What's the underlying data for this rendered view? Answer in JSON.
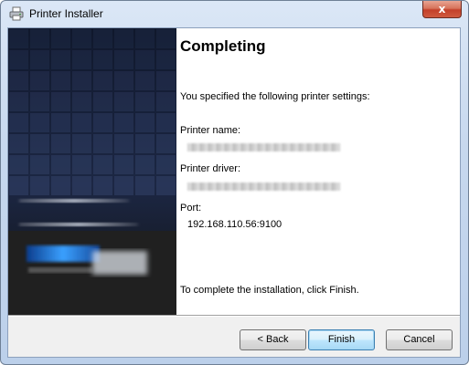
{
  "window": {
    "title": "Printer Installer",
    "close_label": "x"
  },
  "wizard": {
    "heading": "Completing",
    "intro": "You specified the following printer settings:",
    "printer_name_label": "Printer name:",
    "printer_name_value": "",
    "printer_driver_label": "Printer driver:",
    "printer_driver_value": "",
    "port_label": "Port:",
    "port_value": "192.168.110.56:9100",
    "footer": "To complete the installation, click Finish."
  },
  "buttons": {
    "back": "< Back",
    "finish": "Finish",
    "cancel": "Cancel"
  },
  "icons": {
    "title": "printer-icon",
    "close": "close-icon"
  },
  "colors": {
    "banner_dark": "#1a2238",
    "banner_tile": "#2c3a5e",
    "close_red": "#c3402a",
    "default_button_border": "#3c7fb1"
  }
}
